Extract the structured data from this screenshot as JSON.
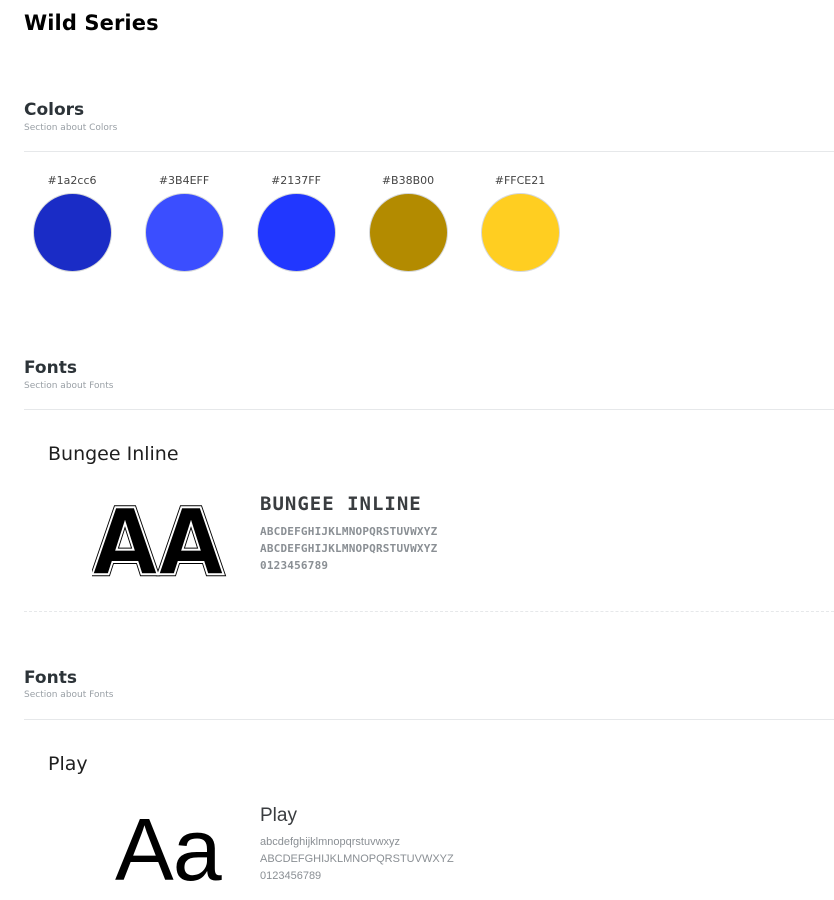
{
  "page": {
    "title": "Wild Series"
  },
  "colors_section": {
    "title": "Colors",
    "subtitle": "Section about Colors",
    "swatches": [
      {
        "label": "#1a2cc6",
        "color": "#1a2cc6"
      },
      {
        "label": "#3B4EFF",
        "color": "#3B4EFF"
      },
      {
        "label": "#2137FF",
        "color": "#2137FF"
      },
      {
        "label": "#B38B00",
        "color": "#B38B00"
      },
      {
        "label": "#FFCE21",
        "color": "#FFCE21"
      }
    ]
  },
  "fonts_section_1": {
    "title": "Fonts",
    "subtitle": "Section about Fonts",
    "font_name": "Bungee Inline",
    "sample": "AA",
    "heading": "BUNGEE INLINE",
    "charset": [
      "ABCDEFGHIJKLMNOPQRSTUVWXYZ",
      "ABCDEFGHIJKLMNOPQRSTUVWXYZ",
      "0123456789"
    ]
  },
  "fonts_section_2": {
    "title": "Fonts",
    "subtitle": "Section about Fonts",
    "font_name": "Play",
    "sample": "Aa",
    "heading": "Play",
    "charset": [
      "abcdefghijklmnopqrstuvwxyz",
      "ABCDEFGHIJKLMNOPQRSTUVWXYZ",
      "0123456789"
    ]
  }
}
